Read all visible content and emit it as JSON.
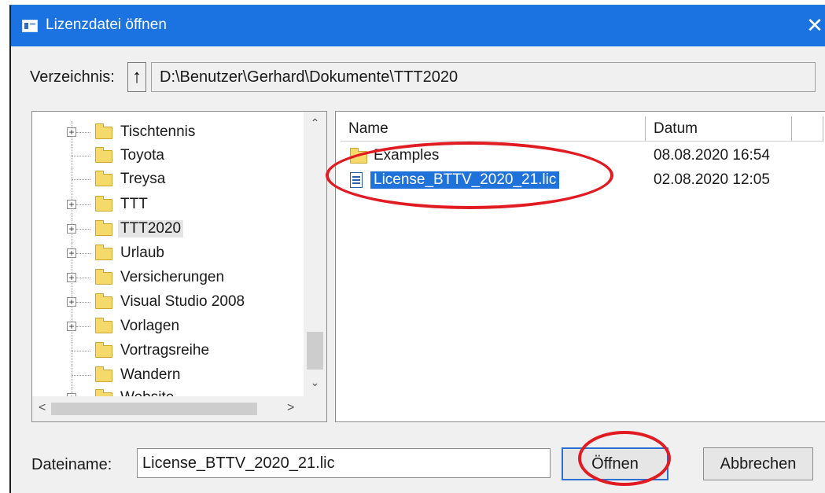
{
  "window": {
    "title": "Lizenzdatei öffnen",
    "close_glyph": "✕"
  },
  "directory": {
    "label": "Verzeichnis:",
    "up_glyph": "↑",
    "path": "D:\\Benutzer\\Gerhard\\Dokumente\\TTT2020"
  },
  "tree": {
    "items": [
      {
        "label": "Tischtennis",
        "expandable": true
      },
      {
        "label": "Toyota",
        "expandable": false
      },
      {
        "label": "Treysa",
        "expandable": false
      },
      {
        "label": "TTT",
        "expandable": true
      },
      {
        "label": "TTT2020",
        "expandable": true,
        "selected": true
      },
      {
        "label": "Urlaub",
        "expandable": true
      },
      {
        "label": "Versicherungen",
        "expandable": true
      },
      {
        "label": "Visual Studio 2008",
        "expandable": true
      },
      {
        "label": "Vorlagen",
        "expandable": true
      },
      {
        "label": "Vortragsreihe",
        "expandable": false
      },
      {
        "label": "Wandern",
        "expandable": false
      },
      {
        "label": "Website",
        "expandable": true
      }
    ],
    "scroll_up": "⌃",
    "scroll_down": "⌄",
    "scroll_left": "<",
    "scroll_right": ">"
  },
  "files": {
    "columns": [
      "Name",
      "Datum"
    ],
    "rows": [
      {
        "name": "Examples",
        "date": "08.08.2020 16:54",
        "type": "folder-icon"
      },
      {
        "name": "License_BTTV_2020_21.lic",
        "date": "02.08.2020 12:05",
        "type": "document-icon",
        "selected": true
      }
    ]
  },
  "filename": {
    "label": "Dateiname:",
    "value": "License_BTTV_2020_21.lic"
  },
  "buttons": {
    "open": "Öffnen",
    "cancel": "Abbrechen"
  },
  "colors": {
    "titlebar": "#1a73e0",
    "selection": "#1f72d9",
    "annotation": "#e11b22"
  }
}
